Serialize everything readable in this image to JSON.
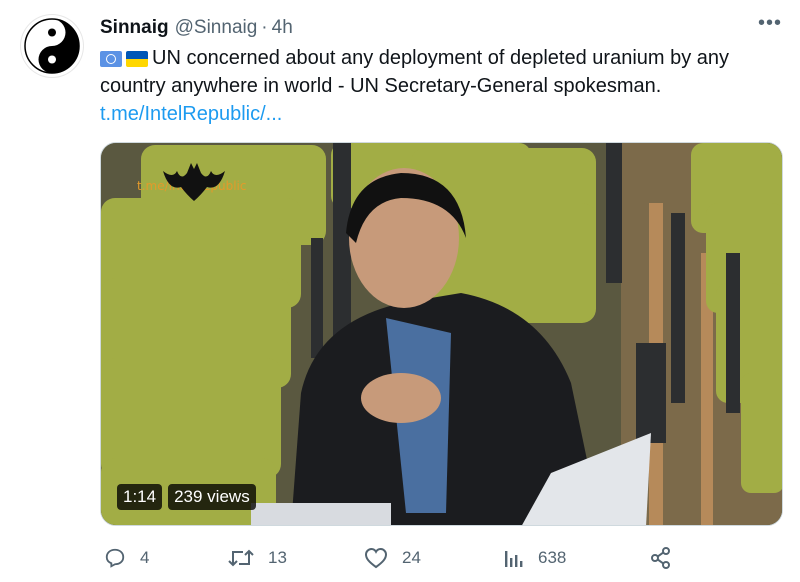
{
  "author": {
    "name": "Sinnaig",
    "handle": "@Sinnaig",
    "separator": "·",
    "time": "4h"
  },
  "more_label": "•••",
  "tweet": {
    "flags": [
      "un-flag-icon",
      "ukraine-flag-icon"
    ],
    "text": "UN concerned about any deployment of depleted uranium by any country anywhere in world - UN Secretary-General spokesman.",
    "link": "t.me/IntelRepublic/..."
  },
  "media": {
    "watermark": "t.me/IntelRepublic",
    "duration": "1:14",
    "views": "239 views"
  },
  "actions": {
    "replies": "4",
    "retweets": "13",
    "likes": "24",
    "views": "638"
  },
  "colors": {
    "link": "#1d9bf0",
    "muted": "#536471",
    "seat": "#9aa53a"
  }
}
